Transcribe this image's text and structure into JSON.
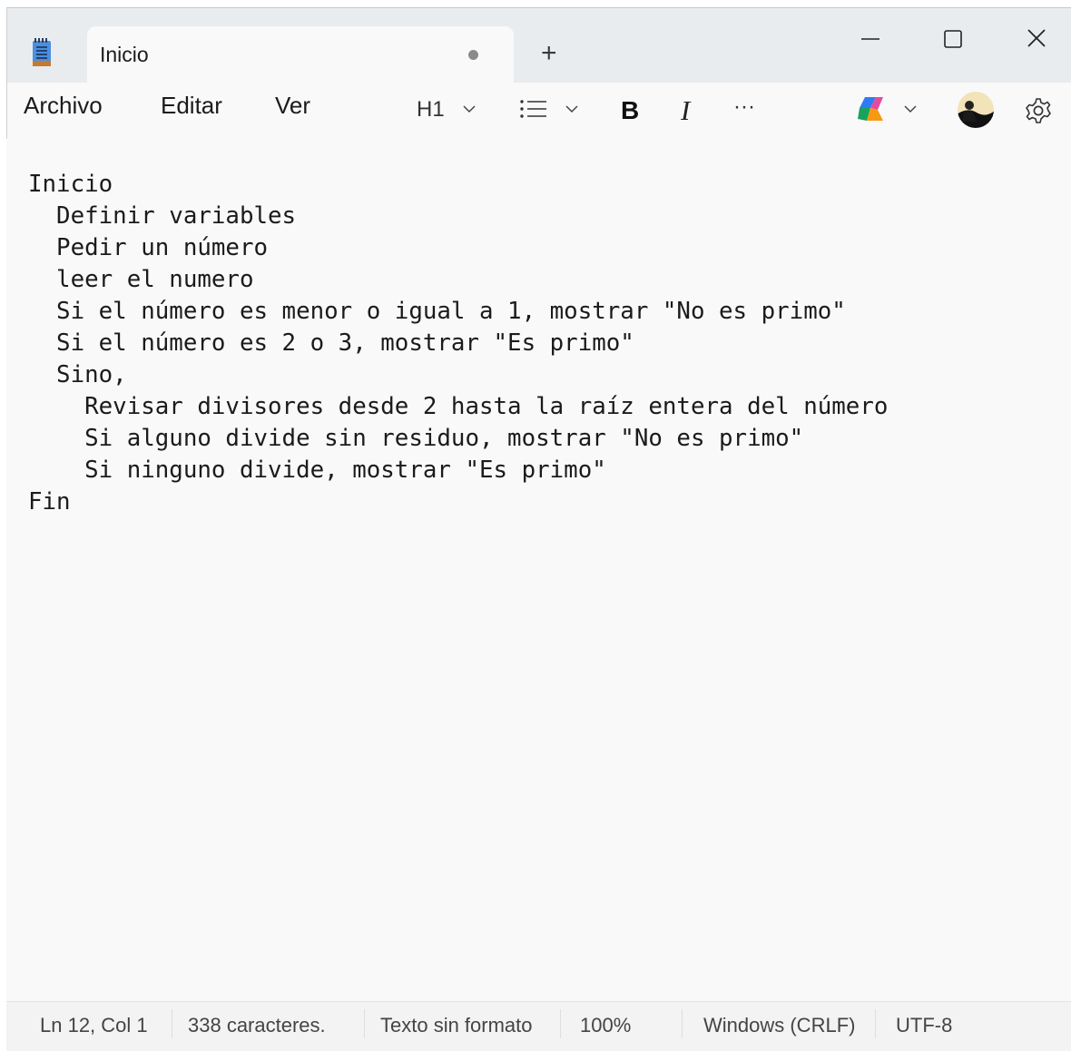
{
  "tab": {
    "title": "Inicio",
    "unsaved_indicator": "unsaved-dot",
    "new_tab": "+"
  },
  "window_controls": [
    "minimize-icon",
    "maximize-icon",
    "close-icon"
  ],
  "menu": {
    "archivo": "Archivo",
    "editar": "Editar",
    "ver": "Ver"
  },
  "toolbar": {
    "heading": "H1",
    "list_icon": "list-icon",
    "bold": "B",
    "italic": "I",
    "more": "···",
    "copilot_icon": "copilot-icon",
    "avatar_icon": "avatar",
    "settings_icon": "gear-icon"
  },
  "editor": {
    "lines": [
      "Inicio",
      "  Definir variables",
      "  Pedir un número",
      "  leer el numero",
      "  Si el número es menor o igual a 1, mostrar \"No es primo\"",
      "  Si el número es 2 o 3, mostrar \"Es primo\"",
      "  Sino,",
      "    Revisar divisores desde 2 hasta la raíz entera del número",
      "    Si alguno divide sin residuo, mostrar \"No es primo\"",
      "    Si ninguno divide, mostrar \"Es primo\"",
      "Fin"
    ]
  },
  "status": {
    "position": "Ln 12, Col 1",
    "chars": "338 caracteres.",
    "format": "Texto sin formato",
    "zoom": "100%",
    "line_ending": "Windows (CRLF)",
    "encoding": "UTF-8"
  },
  "colors": {
    "accent_notepad": "#3b82d6",
    "titlebar": "#e9ecef"
  }
}
